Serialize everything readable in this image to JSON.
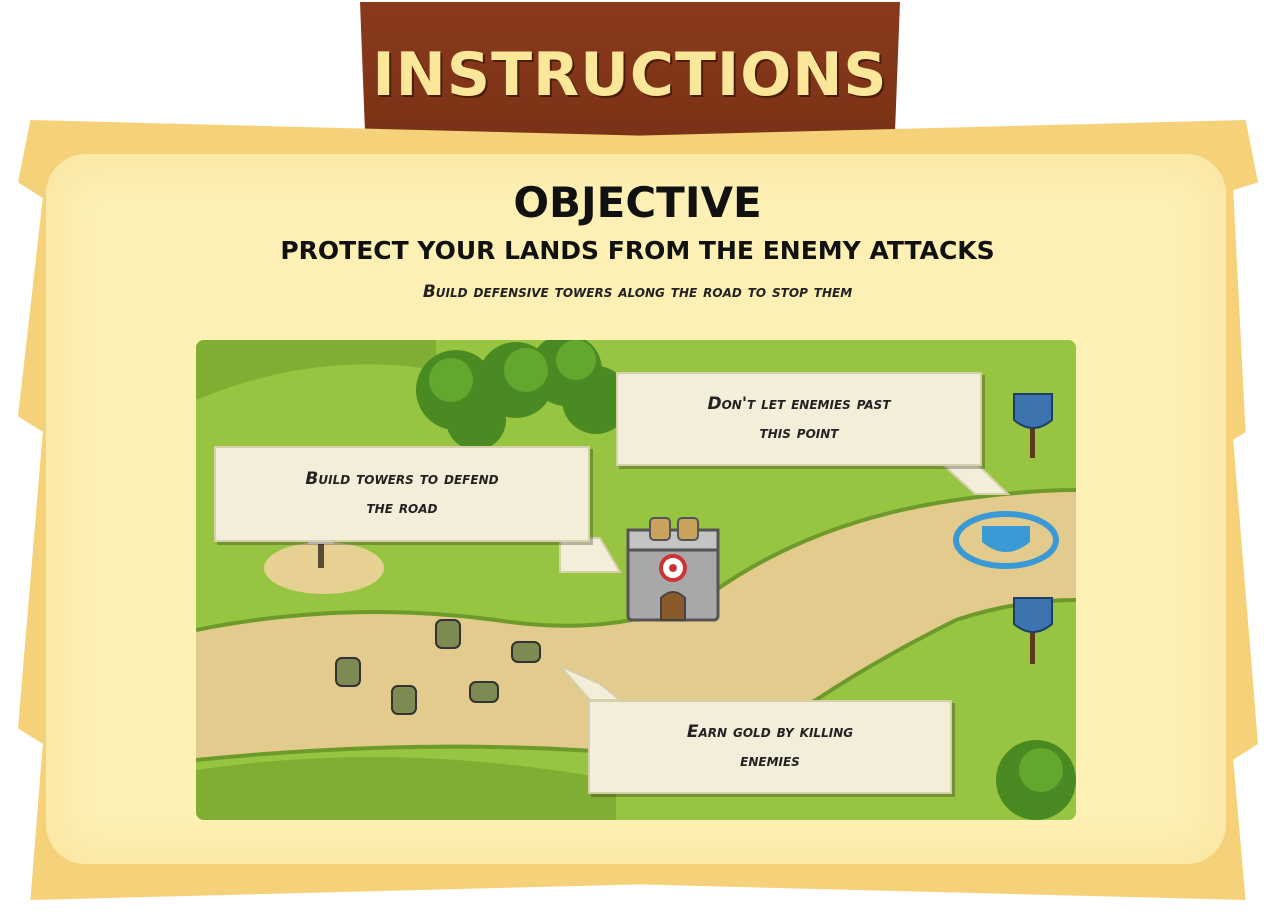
{
  "header": {
    "title": "INSTRUCTIONS"
  },
  "objective": {
    "title": "OBJECTIVE",
    "subtitle": "PROTECT YOUR LANDS FROM THE ENEMY ATTACKS",
    "hint": "Build defensive towers along the road to stop them"
  },
  "callouts": {
    "towers": {
      "line1": "Build towers to defend",
      "line2": "the road"
    },
    "exit": {
      "line1": "Don't let enemies past",
      "line2": "this point"
    },
    "gold": {
      "line1": "Earn gold by killing",
      "line2": "enemies"
    }
  },
  "colors": {
    "banner": "#7a3115",
    "banner_text": "#fbe79a",
    "parchment": "#f5d27a",
    "grass": "#8fbf3c",
    "road": "#e0c98a"
  }
}
